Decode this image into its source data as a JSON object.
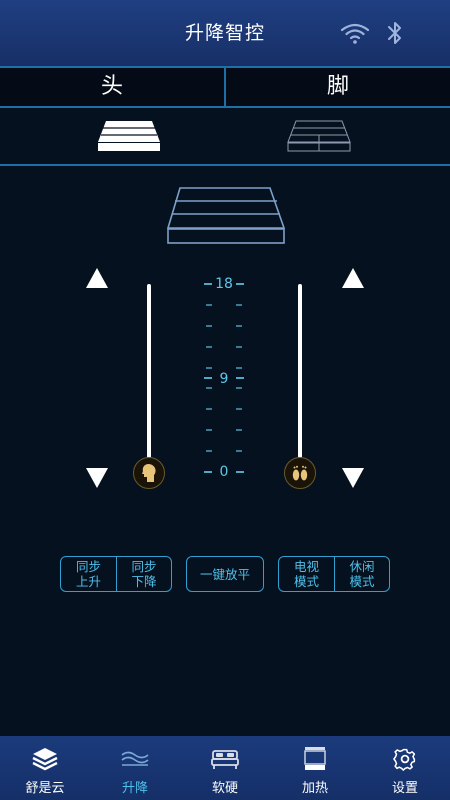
{
  "header": {
    "title": "升降智控",
    "wifi_icon": "wifi-icon",
    "bluetooth_icon": "bluetooth-icon"
  },
  "tabs": [
    {
      "label": "头"
    },
    {
      "label": "脚"
    }
  ],
  "bed_icons": {
    "head": "bed-head-icon",
    "foot": "bed-foot-icon"
  },
  "controls": {
    "scale": {
      "max_label": "18",
      "mid_label": "9",
      "min_label": "0"
    },
    "head_slider": {
      "level": 0,
      "icon": "head-icon"
    },
    "foot_slider": {
      "level": 0,
      "icon": "feet-icon"
    }
  },
  "buttons": {
    "sync_up": "同步\n上升",
    "sync_down": "同步\n下降",
    "one_key_flat": "一键放平",
    "tv_mode": "电视\n模式",
    "leisure_mode": "休闲\n模式"
  },
  "bottom_nav": [
    {
      "label": "舒是云",
      "icon": "layers-icon",
      "active": false
    },
    {
      "label": "升降",
      "icon": "waves-icon",
      "active": true
    },
    {
      "label": "软硬",
      "icon": "bed-icon",
      "active": false
    },
    {
      "label": "加热",
      "icon": "heating-icon",
      "active": false
    },
    {
      "label": "设置",
      "icon": "gear-icon",
      "active": false
    }
  ],
  "colors": {
    "accent": "#4fc0ea",
    "header_bg": "#1f3f82",
    "background": "#06111f"
  }
}
